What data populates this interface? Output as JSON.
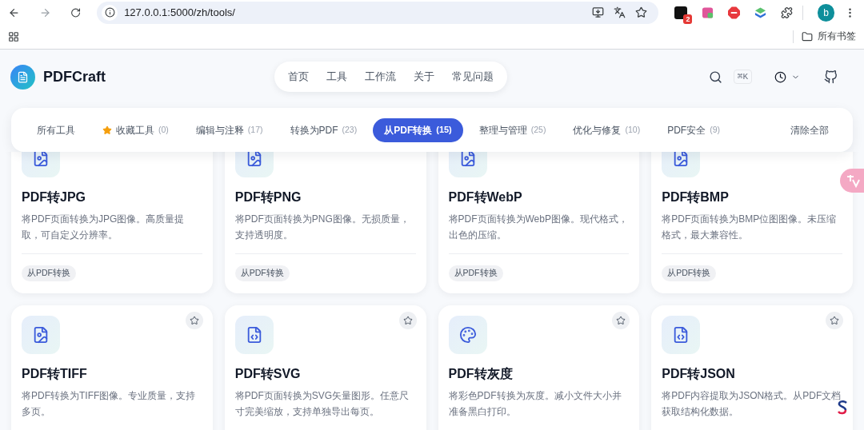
{
  "browser": {
    "address": "127.0.0.1:5000/zh/tools/",
    "extension_badge": "2",
    "profile_initial": "b",
    "bookmarks_folder": "所有书签"
  },
  "site": {
    "logo": "PDFCraft",
    "nav": [
      "首页",
      "工具",
      "工作流",
      "关于",
      "常见问题"
    ],
    "search_shortcut": "⌘K"
  },
  "filters": [
    {
      "kind": "plain",
      "label": "所有工具",
      "selected": false
    },
    {
      "kind": "favorites",
      "label": "收藏工具",
      "count": "(0)",
      "selected": false
    },
    {
      "kind": "plain",
      "label": "编辑与注释",
      "count": "(17)",
      "selected": false
    },
    {
      "kind": "plain",
      "label": "转换为PDF",
      "count": "(23)",
      "selected": false
    },
    {
      "kind": "plain",
      "label": "从PDF转换",
      "count": "(15)",
      "selected": true
    },
    {
      "kind": "plain",
      "label": "整理与管理",
      "count": "(25)",
      "selected": false
    },
    {
      "kind": "plain",
      "label": "优化与修复",
      "count": "(10)",
      "selected": false
    },
    {
      "kind": "plain",
      "label": "PDF安全",
      "count": "(9)",
      "selected": false
    }
  ],
  "clear_all": "清除全部",
  "cards": [
    {
      "kind": "image",
      "title": "PDF转JPG",
      "description": "将PDF页面转换为JPG图像。高质量提取，可自定义分辨率。",
      "tag": "从PDF转换"
    },
    {
      "kind": "image",
      "title": "PDF转PNG",
      "description": "将PDF页面转换为PNG图像。无损质量，支持透明度。",
      "tag": "从PDF转换"
    },
    {
      "kind": "image",
      "title": "PDF转WebP",
      "description": "将PDF页面转换为WebP图像。现代格式，出色的压缩。",
      "tag": "从PDF转换"
    },
    {
      "kind": "image",
      "title": "PDF转BMP",
      "description": "将PDF页面转换为BMP位图图像。未压缩格式，最大兼容性。",
      "tag": "从PDF转换"
    },
    {
      "kind": "image",
      "title": "PDF转TIFF",
      "description": "将PDF转换为TIFF图像。专业质量，支持多页。",
      "favorited": false
    },
    {
      "kind": "code",
      "title": "PDF转SVG",
      "description": "将PDF页面转换为SVG矢量图形。任意尺寸完美缩放，支持单独导出每页。",
      "favorited": false
    },
    {
      "kind": "palette",
      "title": "PDF转灰度",
      "description": "将彩色PDF转换为灰度。减小文件大小并准备黑白打印。",
      "favorited": false
    },
    {
      "kind": "code",
      "title": "PDF转JSON",
      "description": "将PDF内容提取为JSON格式。从PDF文档获取结构化数据。",
      "favorited": false
    }
  ]
}
